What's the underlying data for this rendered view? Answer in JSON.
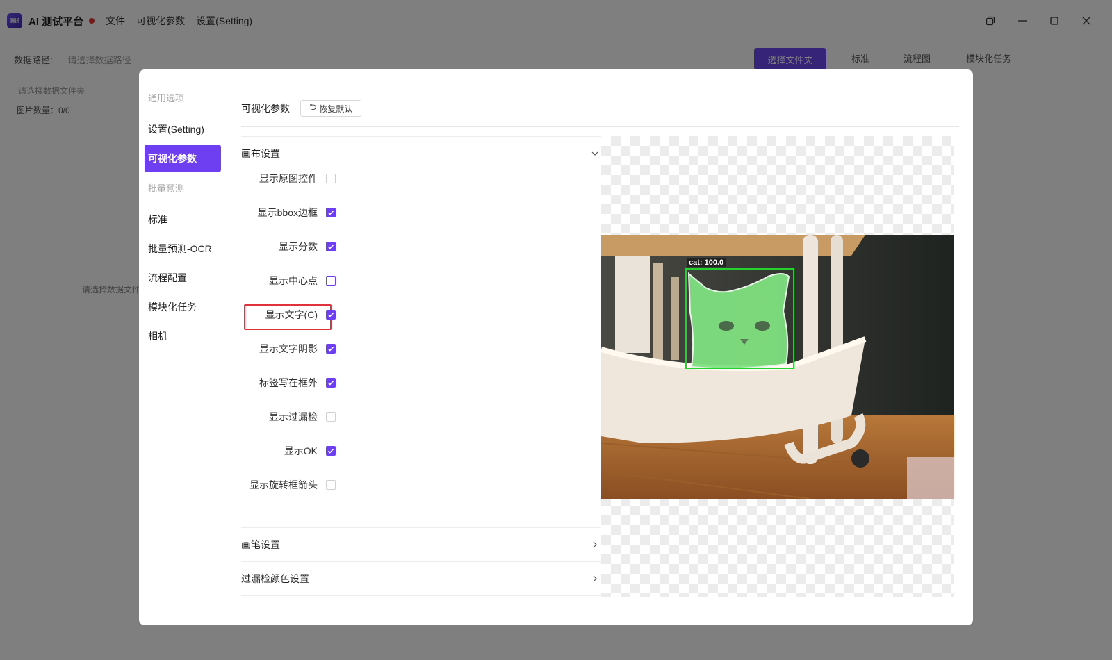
{
  "app": {
    "title": "AI 测试平台",
    "logo_text": "测试",
    "menu": [
      "文件",
      "可视化参数",
      "设置(Setting)"
    ]
  },
  "background": {
    "data_path_label": "数据路径:",
    "data_path_placeholder": "请选择数据路径",
    "choose_folder": "选择文件夹",
    "tabs": [
      "标准",
      "流程图",
      "模块化任务"
    ],
    "folder_hint": "请选择数据文件夹",
    "image_count": "图片数量：0/0",
    "faint_text": "请选择数据文件夹"
  },
  "modal": {
    "sidebar": {
      "groups": [
        "通用选项",
        "批量预测"
      ],
      "items": [
        "设置(Setting)",
        "可视化参数",
        "标准",
        "批量预测-OCR",
        "流程配置",
        "模块化任务",
        "相机"
      ],
      "active": "可视化参数"
    },
    "header": {
      "title": "可视化参数",
      "reset_label": "恢复默认"
    },
    "sections": {
      "canvas": "画布设置",
      "pen": "画笔设置",
      "miss_color": "过漏检颜色设置"
    },
    "options": [
      {
        "label": "显示原图控件",
        "checked": false
      },
      {
        "label": "显示bbox边框",
        "checked": true
      },
      {
        "label": "显示分数",
        "checked": true
      },
      {
        "label": "显示中心点",
        "checked": false
      },
      {
        "label": "显示文字(C)",
        "checked": true
      },
      {
        "label": "显示文字阴影",
        "checked": true
      },
      {
        "label": "标签写在框外",
        "checked": true
      },
      {
        "label": "显示过漏检",
        "checked": false
      },
      {
        "label": "显示OK",
        "checked": true
      },
      {
        "label": "显示旋转框箭头",
        "checked": false
      }
    ],
    "preview": {
      "bbox_label": "cat: 100.0",
      "bbox_color": "#22d22e",
      "mask_color": "#7fe07f"
    }
  },
  "colors": {
    "accent": "#6d3ff0",
    "highlight": "#e0323c"
  }
}
